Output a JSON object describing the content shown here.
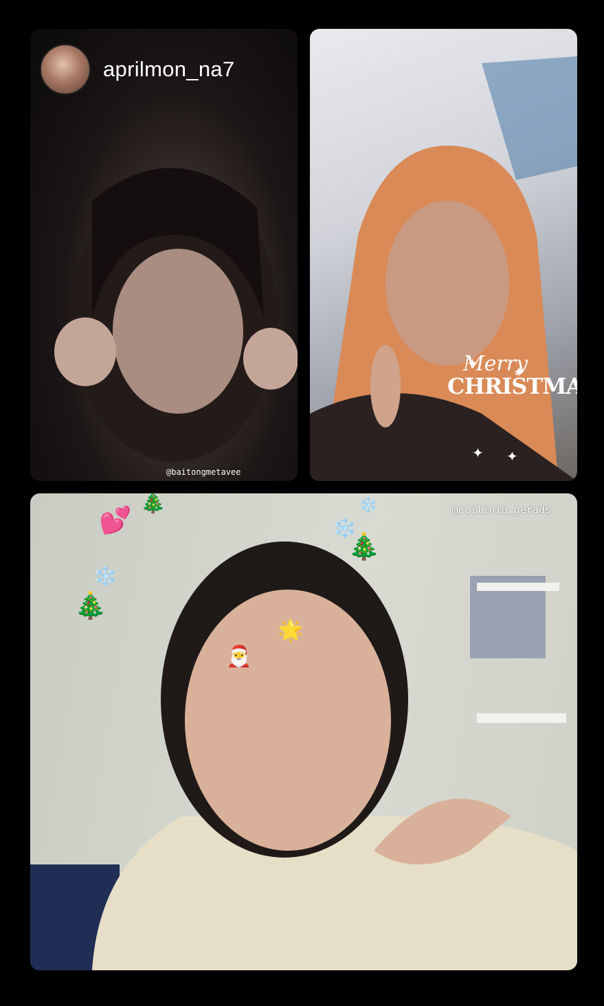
{
  "participants": [
    {
      "username": "aprilmon_na7",
      "tag": "@baitongmetavee"
    },
    {
      "sticker": {
        "line1": "Merry",
        "line2": "CHRISTMAS"
      }
    },
    {
      "tag": "@ccilinia_gerads"
    }
  ],
  "icons": {
    "sparkle": "✦",
    "heart": "💕",
    "tree": "🎄",
    "snowflake": "❄️",
    "emoji_a": "🎅",
    "emoji_b": "🌟"
  }
}
